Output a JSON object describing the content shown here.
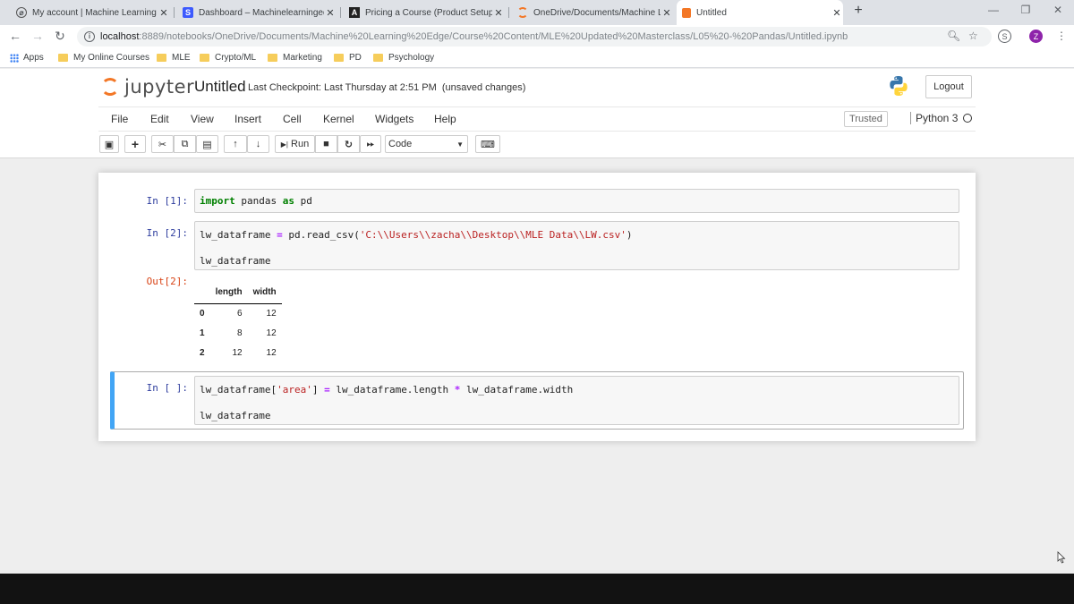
{
  "browser": {
    "tabs": [
      {
        "title": "My account | Machine Learning"
      },
      {
        "title": "Dashboard – Machinelearninged"
      },
      {
        "title": "Pricing a Course (Product Setup)"
      },
      {
        "title": "OneDrive/Documents/Machine L"
      },
      {
        "title": "Untitled"
      }
    ],
    "url_host": "localhost",
    "url_rest": ":8889/notebooks/OneDrive/Documents/Machine%20Learning%20Edge/Course%20Content/MLE%20Updated%20Masterclass/L05%20-%20Pandas/Untitled.ipynb",
    "profile_initial": "Z",
    "bookmarks": [
      "Apps",
      "My Online Courses",
      "MLE",
      "Crypto/ML",
      "Marketing",
      "PD",
      "Psychology"
    ]
  },
  "jupyter": {
    "logo_text": "jupyter",
    "notebook_title": "Untitled",
    "checkpoint": "Last Checkpoint: Last Thursday at 2:51 PM",
    "save_status": "(unsaved changes)",
    "logout_label": "Logout",
    "menu": [
      "File",
      "Edit",
      "View",
      "Insert",
      "Cell",
      "Kernel",
      "Widgets",
      "Help"
    ],
    "trusted_label": "Trusted",
    "kernel_name": "Python 3",
    "run_label": "Run",
    "cell_type": "Code"
  },
  "cells": {
    "c1": {
      "prompt": "In [1]:",
      "kw1": "import",
      "mod": " pandas ",
      "kw2": "as",
      "alias": " pd"
    },
    "c2": {
      "prompt": "In [2]:",
      "lhs": "lw_dataframe ",
      "eq": "=",
      "call": " pd.read_csv(",
      "path": "'C:\\\\Users\\\\zacha\\\\Desktop\\\\MLE Data\\\\LW.csv'",
      "close": ")",
      "line2": "lw_dataframe"
    },
    "out2": {
      "prompt": "Out[2]:",
      "columns": [
        "length",
        "width"
      ],
      "rows": [
        {
          "index": "0",
          "length": "6",
          "width": "12"
        },
        {
          "index": "1",
          "length": "8",
          "width": "12"
        },
        {
          "index": "2",
          "length": "12",
          "width": "12"
        }
      ]
    },
    "c3": {
      "prompt": "In [ ]:",
      "lhs": "lw_dataframe[",
      "key": "'area'",
      "rb": "] ",
      "eq": "=",
      "mid": " lw_dataframe.length ",
      "mul": "*",
      "rhs": " lw_dataframe.width",
      "line2": "lw_dataframe"
    }
  }
}
